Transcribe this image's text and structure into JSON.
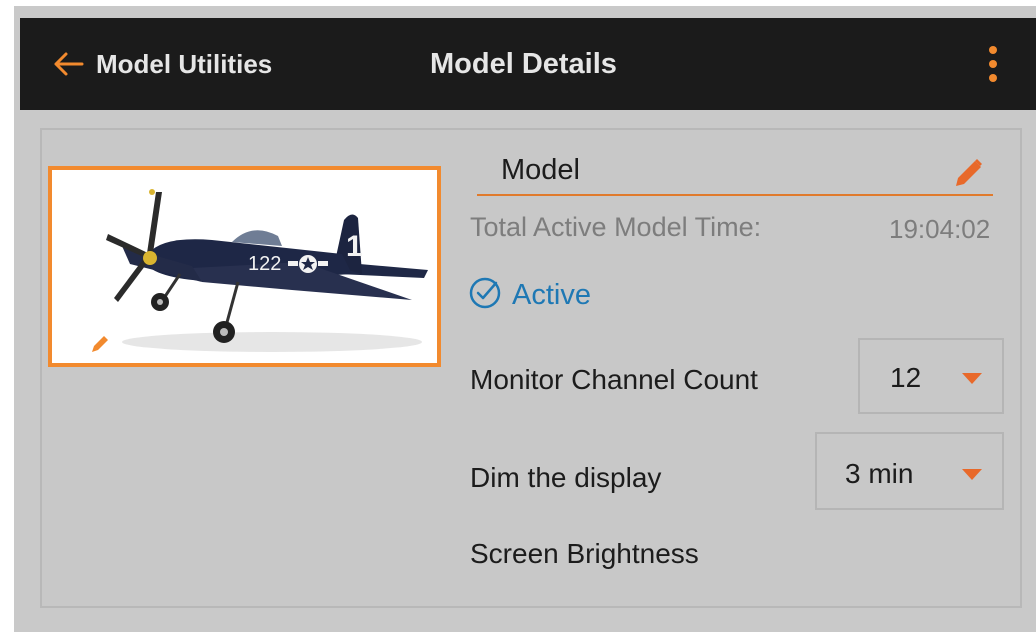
{
  "header": {
    "back_label": "Model Utilities",
    "title": "Model Details",
    "back_icon": "arrow-left-icon",
    "menu_icon": "more-vertical-icon",
    "accent_color": "#f28a2e"
  },
  "model": {
    "name": "Model",
    "total_time_label": "Total Active Model Time:",
    "total_time_value": "19:04:02",
    "active_label": "Active",
    "active_color": "#1e78b4",
    "image_icon": "airplane-image",
    "edit_icon": "pencil-icon"
  },
  "settings": {
    "monitor_channel_label": "Monitor Channel Count",
    "monitor_channel_value": "12",
    "dim_display_label": "Dim the display",
    "dim_display_value": "3 min",
    "screen_brightness_label": "Screen Brightness"
  }
}
